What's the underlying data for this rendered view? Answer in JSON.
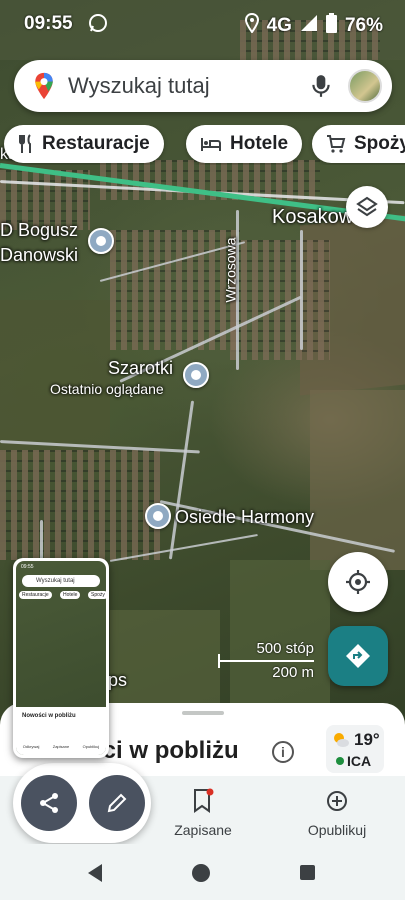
{
  "status_bar": {
    "time": "09:55",
    "network": "4G",
    "battery": "76%",
    "icons": [
      "whatsapp-icon",
      "location-icon",
      "signal-icon",
      "battery-icon"
    ]
  },
  "search": {
    "placeholder": "Wyszukaj tutaj",
    "icons": [
      "maps-pin-icon",
      "mic-icon",
      "avatar"
    ]
  },
  "chips": [
    {
      "label": "Restauracje",
      "icon": "fork-knife-icon"
    },
    {
      "label": "Hotele",
      "icon": "bed-icon"
    },
    {
      "label": "Spoży",
      "icon": "cart-icon"
    }
  ],
  "map_labels": {
    "bogusz": "D Bogusz",
    "danowski": "Danowski",
    "kosakowo": "Kosakow",
    "wrzosowa": "Wrzosowa",
    "ka": "ka",
    "szarotki": "Szarotki",
    "recently_viewed": "Ostatnio oglądane",
    "osiedle": "Osiedle Harmony",
    "ps": "ps"
  },
  "scale": {
    "feet": "500 stóp",
    "meters": "200 m"
  },
  "bottom_sheet": {
    "title": "Nowości w pobliżu",
    "info_icon": "i"
  },
  "weather": {
    "temperature": "19°",
    "air_quality": "ICA",
    "icon": "partly-cloudy-icon",
    "aqi_color": "#1e8e3e"
  },
  "bottom_nav": {
    "saved_label": "Zapisane",
    "publish_label": "Opublikuj"
  },
  "thumbnail": {
    "search": "Wyszukaj tutaj",
    "chip1": "Restauracje",
    "chip2": "Hotele",
    "chip3": "Spoży",
    "time": "09:55",
    "sheet_title": "Nowości w pobliżu",
    "nav1": "Odkrywaj",
    "nav2": "Zapisane",
    "nav3": "Opublikuj"
  },
  "colors": {
    "accent_teal": "#1b7f84",
    "green_road": "#3fbf86",
    "fab": "#4a5260"
  }
}
